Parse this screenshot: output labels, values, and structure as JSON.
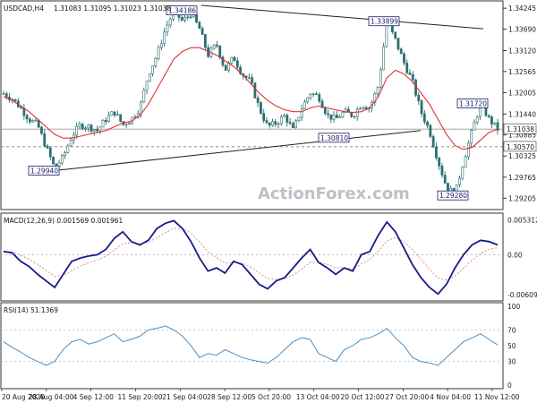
{
  "main_panel": {
    "symbol_label": "USDCAD,H4",
    "ohlc_values": "1.31083 1.31095 1.31023 1.31038",
    "watermark": "ActionForex.com"
  },
  "macd_panel": {
    "header": "MACD(12,26,9) 0.001569 0.001961"
  },
  "rsi_panel": {
    "header": "RSI(14) 51.1369"
  },
  "colors": {
    "candles": "#2b6f73",
    "moving_average": "#e03030",
    "trendlines": "#222222",
    "macd_line": "#1a1a8c",
    "macd_signal": "#e07070",
    "rsi_line": "#4a90c8",
    "tag_border": "#1a1a66"
  },
  "chart_data": [
    {
      "type": "candlestick",
      "title": "USDCAD,H4",
      "ylim": [
        1.29,
        1.3432
      ],
      "y_ticks": [
        "1.34245",
        "1.33690",
        "1.33120",
        "1.32565",
        "1.32005",
        "1.31440",
        "1.30885",
        "1.30325",
        "1.29765",
        "1.29205"
      ],
      "x_tick_labels": [
        "20 Aug 2020",
        "28 Aug 04:00",
        "4 Sep 12:00",
        "11 Sep 20:00",
        "21 Sep 04:00",
        "28 Sep 12:00",
        "5 Oct 20:00",
        "13 Oct 04:00",
        "20 Oct 12:00",
        "27 Oct 20:00",
        "4 Nov 04:00",
        "11 Nov 12:00"
      ],
      "current_price": "1.31038",
      "horizontal_level": "1.30570",
      "annotated_levels": [
        {
          "label": "1.34186",
          "value": 1.34186
        },
        {
          "label": "1.33899",
          "value": 1.33899
        },
        {
          "label": "1.31720",
          "value": 1.3172
        },
        {
          "label": "1.30810",
          "value": 1.3081
        },
        {
          "label": "1.29940",
          "value": 1.2994
        },
        {
          "label": "1.29280",
          "value": 1.2928
        }
      ],
      "trendlines": [
        {
          "name": "upper",
          "from": 1.3432,
          "to": 1.337
        },
        {
          "name": "lower",
          "from": 1.2994,
          "to": 1.31
        }
      ],
      "close_path": [
        1.3198,
        1.3185,
        1.316,
        1.313,
        1.3115,
        1.3055,
        1.3,
        1.303,
        1.3085,
        1.3115,
        1.311,
        1.31,
        1.313,
        1.315,
        1.3115,
        1.313,
        1.316,
        1.325,
        1.33,
        1.337,
        1.3418,
        1.339,
        1.341,
        1.337,
        1.33,
        1.333,
        1.326,
        1.3295,
        1.325,
        1.323,
        1.316,
        1.311,
        1.312,
        1.314,
        1.31,
        1.316,
        1.32,
        1.319,
        1.314,
        1.313,
        1.315,
        1.314,
        1.317,
        1.316,
        1.322,
        1.3388,
        1.334,
        1.328,
        1.323,
        1.315,
        1.31,
        1.302,
        1.295,
        1.293,
        1.302,
        1.31,
        1.3172,
        1.313,
        1.3104
      ],
      "ma_path": [
        1.319,
        1.318,
        1.3165,
        1.315,
        1.313,
        1.311,
        1.309,
        1.308,
        1.308,
        1.3085,
        1.309,
        1.3095,
        1.31,
        1.311,
        1.312,
        1.3125,
        1.314,
        1.317,
        1.321,
        1.325,
        1.329,
        1.331,
        1.332,
        1.332,
        1.331,
        1.33,
        1.3285,
        1.327,
        1.325,
        1.3225,
        1.32,
        1.318,
        1.3165,
        1.3155,
        1.315,
        1.315,
        1.316,
        1.3165,
        1.316,
        1.3155,
        1.315,
        1.3148,
        1.315,
        1.316,
        1.319,
        1.324,
        1.326,
        1.325,
        1.323,
        1.32,
        1.317,
        1.313,
        1.309,
        1.306,
        1.305,
        1.3055,
        1.3075,
        1.3095,
        1.3104
      ]
    },
    {
      "type": "line",
      "title": "MACD(12,26,9)",
      "ylim": [
        -0.0065,
        0.0058
      ],
      "y_ticks": [
        "0.005312",
        "0.00",
        "-0.006092"
      ],
      "series": [
        {
          "name": "MACD",
          "values": [
            0.0005,
            0.0003,
            -0.001,
            -0.0018,
            -0.003,
            -0.004,
            -0.005,
            -0.003,
            -0.001,
            -0.0005,
            -0.0002,
            0.0,
            0.0008,
            0.0025,
            0.0035,
            0.002,
            0.0015,
            0.0022,
            0.004,
            0.0048,
            0.0052,
            0.004,
            0.002,
            -0.0005,
            -0.0025,
            -0.002,
            -0.0028,
            -0.001,
            -0.0015,
            -0.003,
            -0.0045,
            -0.0052,
            -0.004,
            -0.0035,
            -0.002,
            -0.0005,
            0.0008,
            -0.0012,
            -0.002,
            -0.003,
            -0.002,
            -0.0025,
            0.0,
            0.0005,
            0.003,
            0.005,
            0.0035,
            0.001,
            -0.0015,
            -0.0035,
            -0.005,
            -0.006,
            -0.0045,
            -0.002,
            0.0,
            0.0015,
            0.0022,
            0.002,
            0.0015
          ]
        }
      ]
    },
    {
      "type": "line",
      "title": "RSI(14)",
      "ylim": [
        0,
        100
      ],
      "y_ticks": [
        "100",
        "70",
        "50",
        "30",
        "0"
      ],
      "series": [
        {
          "name": "RSI(14)",
          "values": [
            55,
            48,
            42,
            35,
            30,
            25,
            30,
            45,
            55,
            58,
            52,
            55,
            60,
            65,
            55,
            58,
            62,
            70,
            72,
            75,
            70,
            62,
            50,
            35,
            40,
            38,
            45,
            40,
            35,
            32,
            30,
            28,
            35,
            45,
            55,
            60,
            58,
            40,
            35,
            30,
            45,
            50,
            58,
            60,
            65,
            72,
            60,
            50,
            35,
            30,
            28,
            25,
            35,
            45,
            55,
            60,
            65,
            58,
            51
          ]
        }
      ]
    }
  ]
}
